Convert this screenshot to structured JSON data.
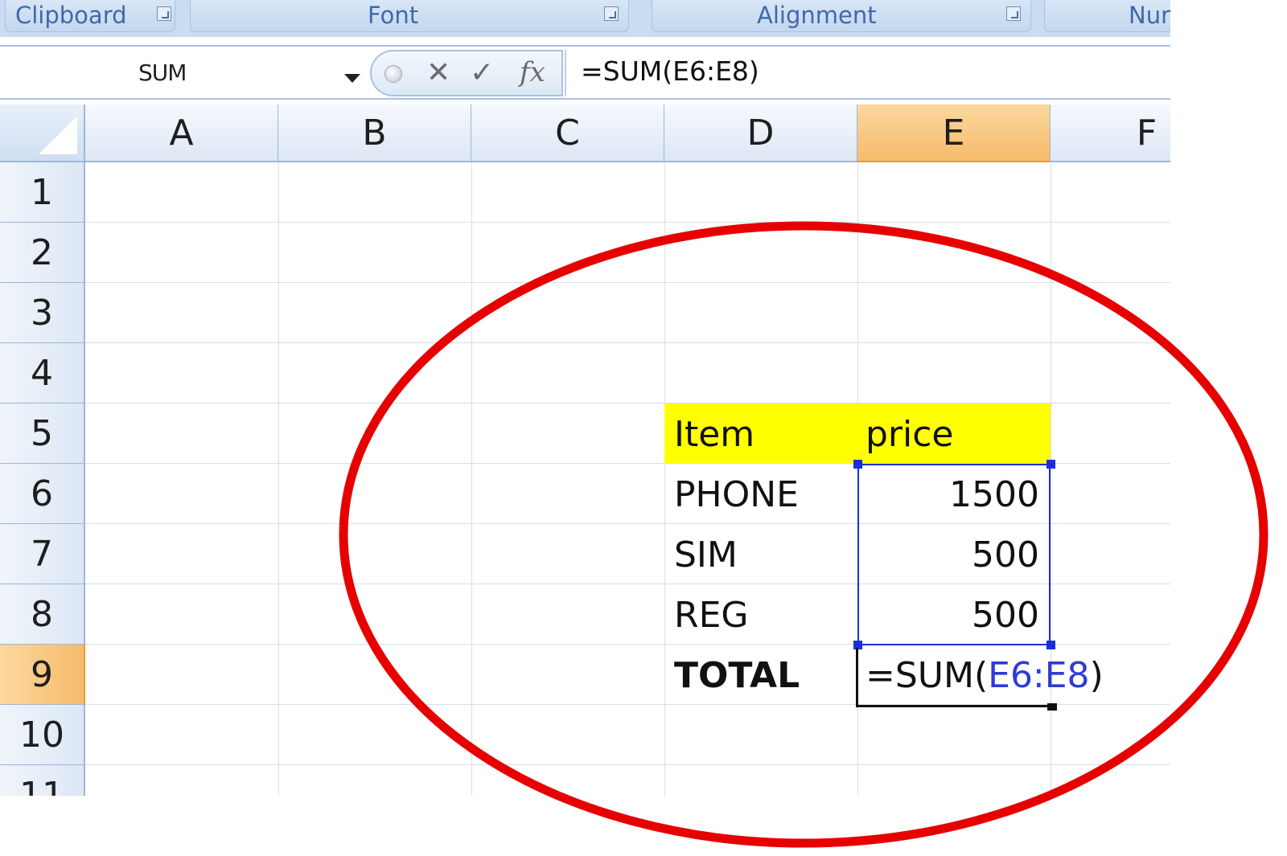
{
  "ribbon": {
    "groups": [
      {
        "label": "Clipboard"
      },
      {
        "label": "Font"
      },
      {
        "label": "Alignment"
      },
      {
        "label": "Nur"
      }
    ]
  },
  "formula_bar": {
    "name_box": "SUM",
    "cancel": "✕",
    "enter": "✓",
    "fx": "fx",
    "formula": "=SUM(E6:E8)"
  },
  "columns": [
    "A",
    "B",
    "C",
    "D",
    "E",
    "F"
  ],
  "rows": [
    "1",
    "2",
    "3",
    "4",
    "5",
    "6",
    "7",
    "8",
    "9",
    "10",
    "11"
  ],
  "selected_column": "E",
  "selected_row": "9",
  "cells": {
    "D5": "Item",
    "E5": "price",
    "D6": "PHONE",
    "E6": "1500",
    "D7": "SIM",
    "E7": "500",
    "D8": "REG",
    "E8": "500",
    "D9": "TOTAL",
    "E9_prefix": "=SUM(",
    "E9_ref": "E6:E8",
    "E9_suffix": ")"
  },
  "colors": {
    "highlight_fill": "#ffff00",
    "selected_header": "#f6bb6a",
    "range_border": "#1a2fd8",
    "annotation_circle": "#e60000"
  }
}
